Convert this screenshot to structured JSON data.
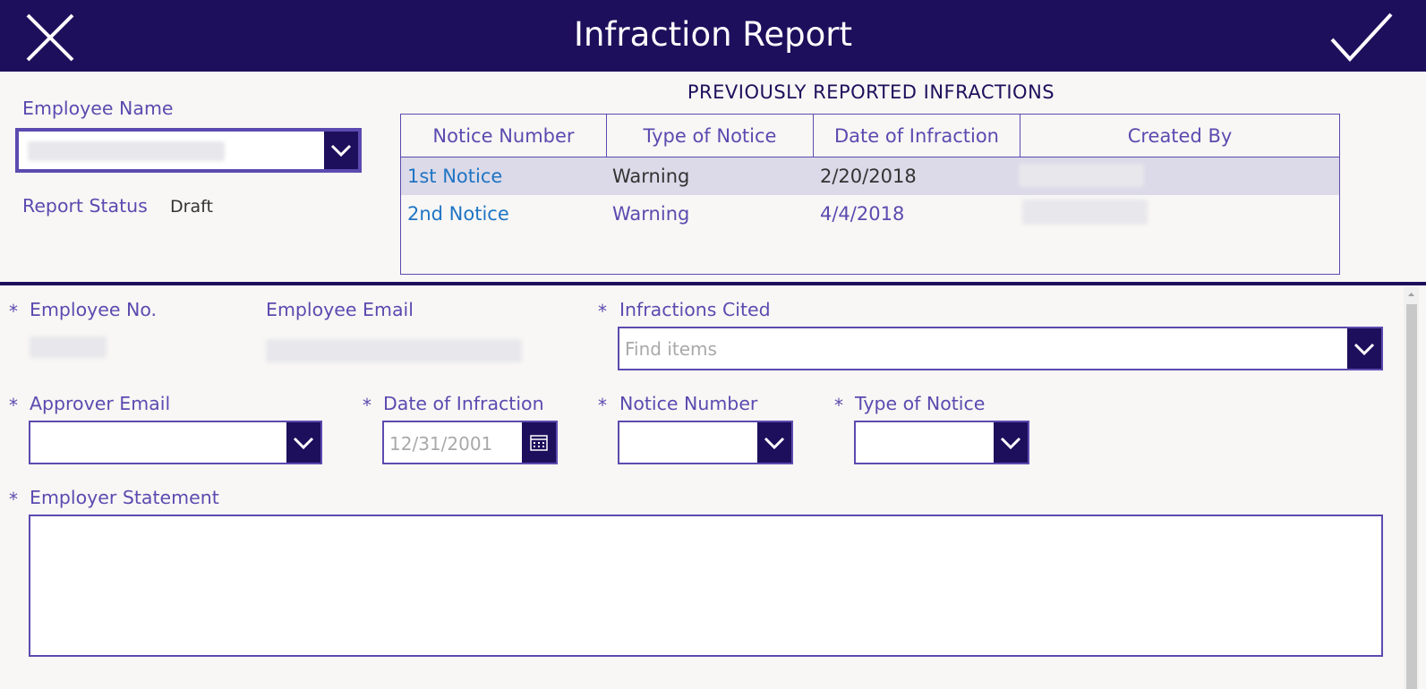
{
  "header": {
    "title": "Infraction Report",
    "close_icon": "close-icon",
    "submit_icon": "checkmark-icon"
  },
  "employee_name": {
    "label": "Employee Name",
    "value": ""
  },
  "report_status": {
    "label": "Report Status",
    "value": "Draft"
  },
  "previous": {
    "title": "PREVIOUSLY REPORTED INFRACTIONS",
    "columns": [
      "Notice Number",
      "Type of Notice",
      "Date of Infraction",
      "Created By"
    ],
    "rows": [
      {
        "notice": "1st Notice",
        "type": "Warning",
        "date": "2/20/2018",
        "created_by": ""
      },
      {
        "notice": "2nd Notice",
        "type": "Warning",
        "date": "4/4/2018",
        "created_by": ""
      }
    ]
  },
  "form": {
    "employee_no": {
      "label": "Employee No.",
      "required": "*",
      "value": ""
    },
    "employee_email": {
      "label": "Employee Email",
      "value": ""
    },
    "infractions_cited": {
      "label": "Infractions Cited",
      "required": "*",
      "placeholder": "Find items"
    },
    "approver_email": {
      "label": "Approver Email",
      "required": "*",
      "value": ""
    },
    "date_of_infraction": {
      "label": "Date of Infraction",
      "required": "*",
      "placeholder": "12/31/2001"
    },
    "notice_number": {
      "label": "Notice Number",
      "required": "*",
      "value": ""
    },
    "type_of_notice": {
      "label": "Type of Notice",
      "required": "*",
      "value": ""
    },
    "employer_statement": {
      "label": "Employer Statement",
      "required": "*",
      "value": ""
    }
  },
  "colors": {
    "header_bg": "#1e0f5c",
    "accent": "#5b4bb0",
    "link": "#1f74c4",
    "selected_row": "#dcdae8"
  }
}
